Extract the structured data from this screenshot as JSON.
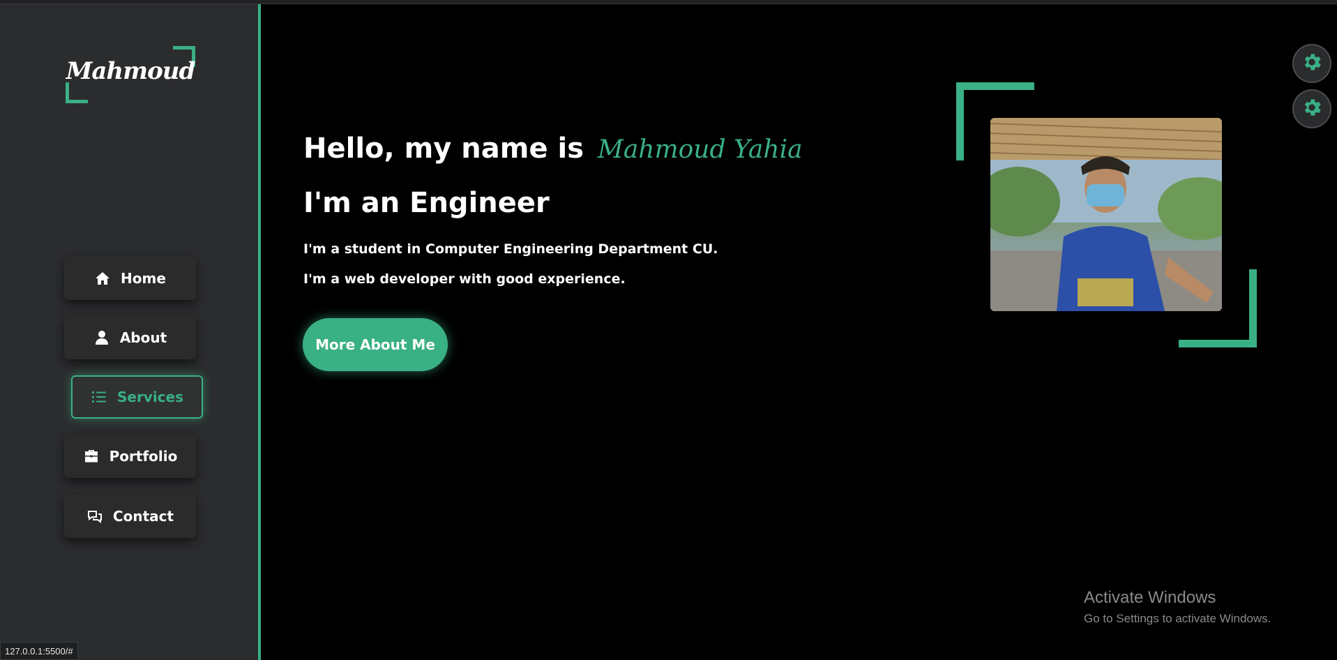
{
  "colors": {
    "accent": "#3ab085",
    "sidebar_bg": "#2b2c2e",
    "main_bg": "#000000"
  },
  "logo": {
    "text": "Mahmoud"
  },
  "nav": {
    "items": [
      {
        "label": "Home",
        "icon": "home-icon",
        "active": false
      },
      {
        "label": "About",
        "icon": "user-icon",
        "active": false
      },
      {
        "label": "Services",
        "icon": "list-icon",
        "active": true
      },
      {
        "label": "Portfolio",
        "icon": "briefcase-icon",
        "active": false
      },
      {
        "label": "Contact",
        "icon": "comments-icon",
        "active": false
      }
    ]
  },
  "hero": {
    "greeting": "Hello, my name is",
    "name": "Mahmoud Yahia",
    "role": "I'm an Engineer",
    "line1": "I'm a student in Computer Engineering Department CU.",
    "line2": "I'm a web developer with good experience.",
    "button_label": "More About Me"
  },
  "settings": {
    "icon": "gear-icon"
  },
  "watermark": {
    "title": "Activate Windows",
    "subtitle": "Go to Settings to activate Windows."
  },
  "statusbar": {
    "url": "127.0.0.1:5500/#"
  }
}
